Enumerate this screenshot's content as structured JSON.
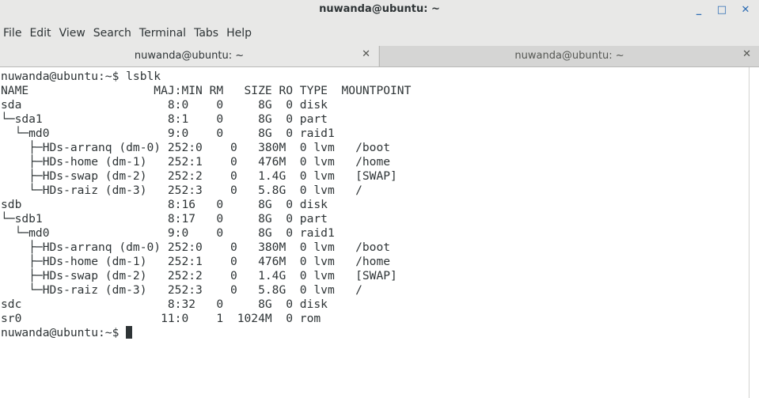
{
  "window": {
    "title": "nuwanda@ubuntu: ~",
    "minimize_glyph": "_",
    "maximize_glyph": "□",
    "close_glyph": "✕"
  },
  "menu": [
    "File",
    "Edit",
    "View",
    "Search",
    "Terminal",
    "Tabs",
    "Help"
  ],
  "tabs": [
    {
      "label": "nuwanda@ubuntu: ~",
      "close": "✕",
      "active": true
    },
    {
      "label": "nuwanda@ubuntu: ~",
      "close": "✕",
      "active": false
    }
  ],
  "terminal": {
    "lines": [
      "nuwanda@ubuntu:~$ lsblk",
      "NAME                  MAJ:MIN RM   SIZE RO TYPE  MOUNTPOINT",
      "sda                     8:0    0     8G  0 disk",
      "└─sda1                  8:1    0     8G  0 part",
      "  └─md0                 9:0    0     8G  0 raid1",
      "    ├─HDs-arranq (dm-0) 252:0    0   380M  0 lvm   /boot",
      "    ├─HDs-home (dm-1)   252:1    0   476M  0 lvm   /home",
      "    ├─HDs-swap (dm-2)   252:2    0   1.4G  0 lvm   [SWAP]",
      "    └─HDs-raiz (dm-3)   252:3    0   5.8G  0 lvm   /",
      "sdb                     8:16   0     8G  0 disk",
      "└─sdb1                  8:17   0     8G  0 part",
      "  └─md0                 9:0    0     8G  0 raid1",
      "    ├─HDs-arranq (dm-0) 252:0    0   380M  0 lvm   /boot",
      "    ├─HDs-home (dm-1)   252:1    0   476M  0 lvm   /home",
      "    ├─HDs-swap (dm-2)   252:2    0   1.4G  0 lvm   [SWAP]",
      "    └─HDs-raiz (dm-3)   252:3    0   5.8G  0 lvm   /",
      "sdc                     8:32   0     8G  0 disk",
      "sr0                    11:0    1  1024M  0 rom"
    ],
    "prompt": "nuwanda@ubuntu:~$ "
  }
}
